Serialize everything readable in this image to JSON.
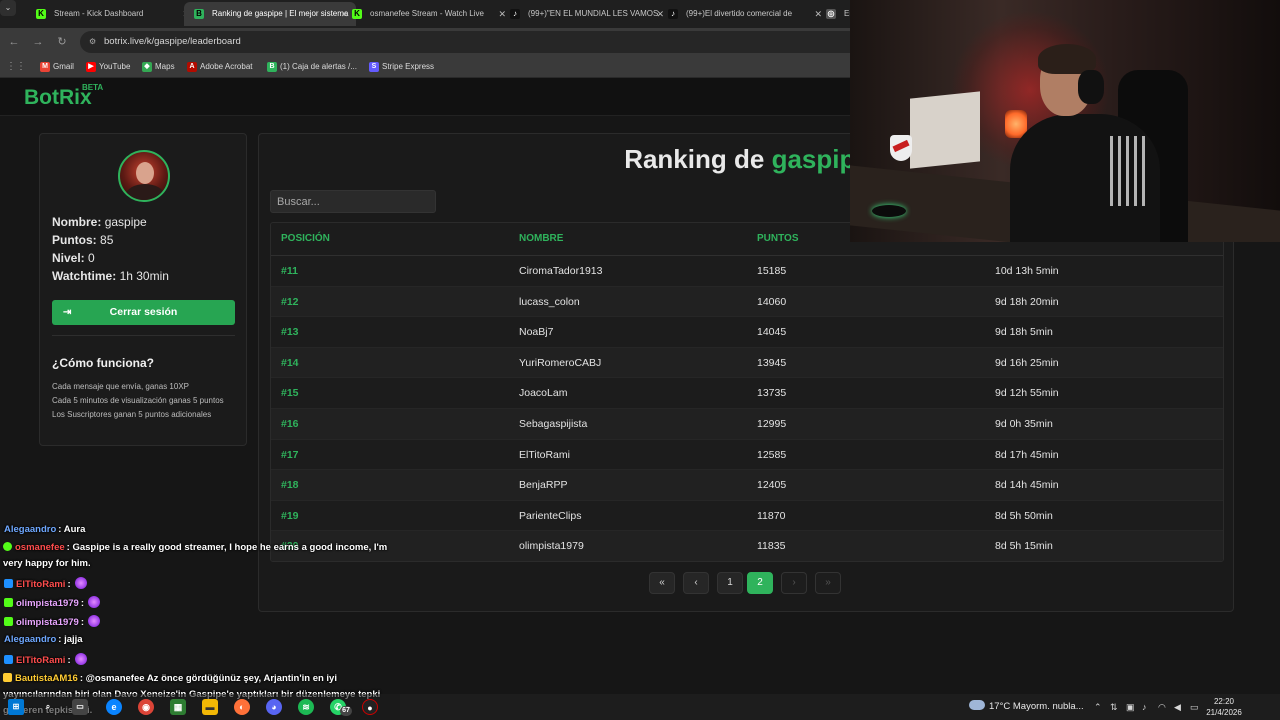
{
  "browser": {
    "tabs": [
      {
        "title": "Stream - Kick Dashboard",
        "icon": "kick-icon",
        "color": "#53fc18",
        "active": false
      },
      {
        "title": "Ranking de gaspipe | El mejor sistema",
        "icon": "botrix-icon",
        "color": "#2fb35c",
        "active": true
      },
      {
        "title": "osmanefee Stream - Watch Live",
        "icon": "kick-icon",
        "color": "#53fc18",
        "active": false
      },
      {
        "title": "(99+)\"EN EL MUNDIAL LES VAMOS",
        "icon": "tiktok-icon",
        "color": "#ffffff",
        "active": false
      },
      {
        "title": "(99+)El divertido comercial de",
        "icon": "tiktok-icon",
        "color": "#ffffff",
        "active": false
      },
      {
        "title": "Em",
        "icon": "globe-icon",
        "color": "#cccccc",
        "active": false
      }
    ],
    "url": "botrix.live/k/gaspipe/leaderboard",
    "bookmarks": [
      {
        "label": "Gmail",
        "color": "#ea4335",
        "glyph": "M"
      },
      {
        "label": "YouTube",
        "color": "#ff0000",
        "glyph": "▶"
      },
      {
        "label": "Maps",
        "color": "#34a853",
        "glyph": "◆"
      },
      {
        "label": "Adobe Acrobat",
        "color": "#b30b00",
        "glyph": "A"
      },
      {
        "label": "(1) Caja de alertas /...",
        "color": "#2fb35c",
        "glyph": "B"
      },
      {
        "label": "Stripe Express",
        "color": "#635bff",
        "glyph": "S"
      }
    ]
  },
  "site": {
    "logo": "BotRix",
    "beta": "BETA"
  },
  "profile": {
    "name_label": "Nombre:",
    "name": "gaspipe",
    "points_label": "Puntos:",
    "points": "85",
    "level_label": "Nivel:",
    "level": "0",
    "watchtime_label": "Watchtime:",
    "watchtime": "1h 30min",
    "logout_label": "Cerrar sesión",
    "how_title": "¿Cómo funciona?",
    "how_lines": [
      "Cada mensaje que envía, ganas 10XP",
      "Cada 5 minutos de visualización ganas 5 puntos",
      "Los Suscriptores ganan 5 puntos adicionales"
    ]
  },
  "leaderboard": {
    "title_prefix": "Ranking de",
    "title_name": "gaspipe",
    "search_placeholder": "Buscar...",
    "columns": [
      "POSICIÓN",
      "NOMBRE",
      "PUNTOS"
    ],
    "rows": [
      {
        "pos": "#11",
        "name": "CiromaTador1913",
        "points": "15185",
        "watchtime": "10d 13h 5min"
      },
      {
        "pos": "#12",
        "name": "lucass_colon",
        "points": "14060",
        "watchtime": "9d 18h 20min"
      },
      {
        "pos": "#13",
        "name": "NoaBj7",
        "points": "14045",
        "watchtime": "9d 18h 5min"
      },
      {
        "pos": "#14",
        "name": "YuriRomeroCABJ",
        "points": "13945",
        "watchtime": "9d 16h 25min"
      },
      {
        "pos": "#15",
        "name": "JoacoLam",
        "points": "13735",
        "watchtime": "9d 12h 55min"
      },
      {
        "pos": "#16",
        "name": "Sebagaspijista",
        "points": "12995",
        "watchtime": "9d 0h 35min"
      },
      {
        "pos": "#17",
        "name": "ElTitoRami",
        "points": "12585",
        "watchtime": "8d 17h 45min"
      },
      {
        "pos": "#18",
        "name": "BenjaRPP",
        "points": "12405",
        "watchtime": "8d 14h 45min"
      },
      {
        "pos": "#19",
        "name": "ParienteClips",
        "points": "11870",
        "watchtime": "8d 5h 50min"
      },
      {
        "pos": "#20",
        "name": "olimpista1979",
        "points": "11835",
        "watchtime": "8d 5h 15min"
      }
    ],
    "pagination": {
      "first": "«",
      "prev": "‹",
      "pages": [
        "1",
        "2"
      ],
      "current": "2",
      "next": "›",
      "last": "»"
    }
  },
  "chat": [
    {
      "user": "Alegaandro",
      "color": "#6fa8ff",
      "badge": null,
      "text": ": Aura",
      "emote": false
    },
    {
      "user": "osmanefee",
      "color": "#ff4d4d",
      "badge": "#53fc18",
      "text": ": Gaspipe is a really good streamer, I hope he earns a good income, I'm very happy for him.",
      "emote": false
    },
    {
      "user": "ElTitoRami",
      "color": "#ff4d4d",
      "badge": "#1e90ff",
      "text": ":",
      "emote": true
    },
    {
      "user": "olimpista1979",
      "color": "#e9a6ff",
      "badge": "#53fc18",
      "text": ":",
      "emote": true
    },
    {
      "user": "olimpista1979",
      "color": "#e9a6ff",
      "badge": "#53fc18",
      "text": ":",
      "emote": true
    },
    {
      "user": "Alegaandro",
      "color": "#6fa8ff",
      "badge": null,
      "text": ": jajja",
      "emote": false
    },
    {
      "user": "ElTitoRami",
      "color": "#ff4d4d",
      "badge": "#1e90ff",
      "text": ":",
      "emote": true
    },
    {
      "user": "BautistaAM16",
      "color": "#ffcc33",
      "badge": "#ffcc33",
      "text": ": @osmanefee Az önce gördüğünüz şey, Arjantin'in en iyi yayıncılarından biri olan Davo Xeneize'in Gaspipe'e yaptıkları bir düzenlemeye tepki gösteren tepkisiydi.",
      "emote": false
    }
  ],
  "taskbar": {
    "weather": "17°C  Mayorm. nubla...",
    "time": "22:20",
    "date": "21/4/2026",
    "badge_count": "67"
  }
}
